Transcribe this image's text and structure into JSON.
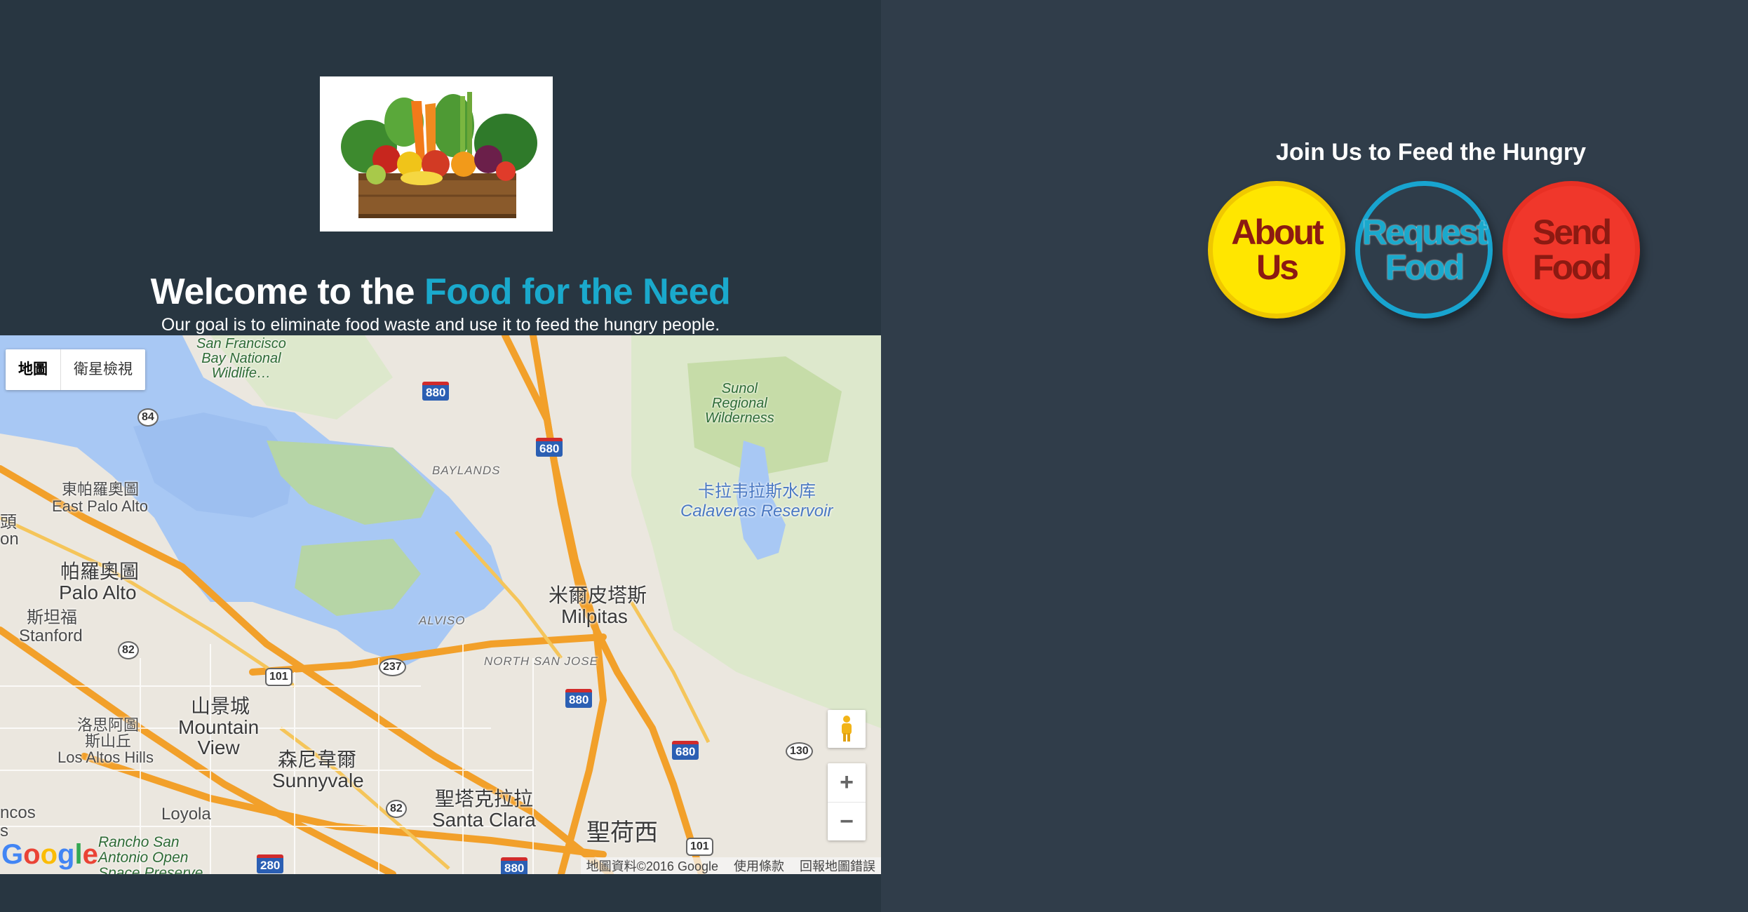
{
  "hero": {
    "image_alt": "Box of fresh vegetables"
  },
  "welcome": {
    "prefix": "Welcome to the ",
    "brand": "Food for the Need",
    "goal": "Our goal is to eliminate food waste and use it to feed the hungry people."
  },
  "map": {
    "type_controls": [
      "地圖",
      "衛星檢視"
    ],
    "zoom_in": "+",
    "zoom_out": "−",
    "labels": {
      "sf_bay": "San Francisco\nBay National\nWildlife…",
      "sunol": "Sunol\nRegional\nWilderness",
      "calaveras_cn": "卡拉韦拉斯水库",
      "calaveras_en": "Calaveras Reservoir",
      "baylands": "BAYLANDS",
      "alviso": "ALVISO",
      "north_san_jose": "NORTH SAN JOSE",
      "east_palo_alto_cn": "東帕羅奧圖",
      "east_palo_alto_en": "East Palo Alto",
      "palo_alto_cn": "帕羅奧圖",
      "palo_alto_en": "Palo Alto",
      "stanford_cn": "斯坦福",
      "stanford_en": "Stanford",
      "milpitas_cn": "米爾皮塔斯",
      "milpitas_en": "Milpitas",
      "mountain_view_cn": "山景城",
      "mountain_view_en": "Mountain\nView",
      "los_altos_hills_cn": "洛思阿圖\n斯山丘",
      "los_altos_hills_en": "Los Altos Hills",
      "sunnyvale_cn": "森尼韋爾",
      "sunnyvale_en": "Sunnyvale",
      "santa_clara_cn": "聖塔克拉拉",
      "santa_clara_en": "Santa Clara",
      "san_jose_cn": "聖荷西",
      "loyola": "Loyola",
      "rancho": "Rancho San\nAntonio Open\nSpace Preserve",
      "left_edge_1": "頭",
      "left_edge_2": "on",
      "left_edge_3": "ncos",
      "left_edge_4": "s"
    },
    "highways": {
      "i880_a": "880",
      "i680_a": "680",
      "i880_b": "880",
      "i680_b": "680",
      "i280": "280",
      "i880_c": "880",
      "us101": "101",
      "us101_b": "101"
    },
    "state_routes": {
      "r84": "84",
      "r82a": "82",
      "r237": "237",
      "r130": "130",
      "r82b": "82"
    },
    "brand": "Google",
    "footer": [
      "地圖資料©2016 Google",
      "使用條款",
      "回報地圖錯誤"
    ]
  },
  "join": {
    "title": "Join Us to Feed the Hungry",
    "about": "About\nUs",
    "request": "Request\nFood",
    "send": "Send\nFood"
  },
  "colors": {
    "left_bg": "#283641",
    "right_bg": "#303d4a",
    "accent": "#1aa9cc",
    "about_yellow": "#ffe600",
    "send_red": "#f0372b",
    "button_text_dark_red": "#8c1a12"
  }
}
